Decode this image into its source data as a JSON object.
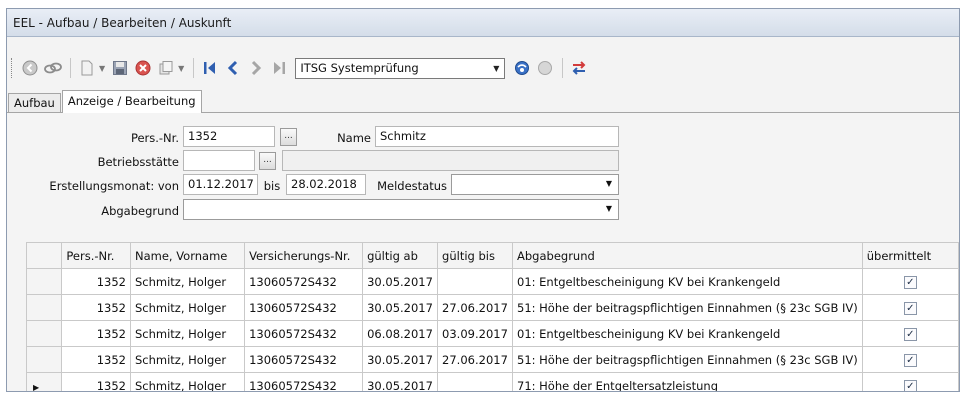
{
  "window": {
    "title": "EEL - Aufbau / Bearbeiten / Auskunft"
  },
  "toolbar": {
    "combo_value": "ITSG Systemprüfung",
    "icons": [
      "back-icon",
      "link-icon",
      "new-document-icon",
      "save-icon",
      "delete-icon",
      "copy-icon",
      "first-record-icon",
      "previous-record-icon",
      "next-record-icon",
      "last-record-icon",
      "run-icon",
      "stop-icon",
      "transfer-icon"
    ]
  },
  "tabs": [
    {
      "label": "Aufbau"
    },
    {
      "label": "Anzeige / Bearbeitung"
    }
  ],
  "form": {
    "pers_nr_label": "Pers.-Nr.",
    "pers_nr_value": "1352",
    "lookup_button": "...",
    "name_label": "Name",
    "name_value": "Schmitz",
    "betriebsstaette_label": "Betriebsstätte",
    "betriebsstaette_value": "",
    "betriebsstaette_desc": "",
    "erstellungsmonat_label": "Erstellungsmonat: von",
    "von_value": "01.12.2017",
    "bis_label": "bis",
    "bis_value": "28.02.2018",
    "meldestatus_label": "Meldestatus",
    "meldestatus_value": "",
    "abgabegrund_label": "Abgabegrund",
    "abgabegrund_value": ""
  },
  "grid": {
    "columns": [
      "Pers.-Nr.",
      "Name, Vorname",
      "Versicherungs-Nr.",
      "gültig ab",
      "gültig bis",
      "Abgabegrund",
      "übermittelt"
    ],
    "rows": [
      {
        "pers_nr": "1352",
        "name": "Schmitz, Holger",
        "vers_nr": "13060572S432",
        "gueltig_ab": "30.05.2017",
        "gueltig_bis": "",
        "abgabegrund": "01: Entgeltbescheinigung KV bei Krankengeld",
        "uebermittelt": "✓"
      },
      {
        "pers_nr": "1352",
        "name": "Schmitz, Holger",
        "vers_nr": "13060572S432",
        "gueltig_ab": "30.05.2017",
        "gueltig_bis": "27.06.2017",
        "abgabegrund": "51: Höhe der beitragspflichtigen Einnahmen (§ 23c SGB IV)",
        "uebermittelt": "✓"
      },
      {
        "pers_nr": "1352",
        "name": "Schmitz, Holger",
        "vers_nr": "13060572S432",
        "gueltig_ab": "06.08.2017",
        "gueltig_bis": "03.09.2017",
        "abgabegrund": "01: Entgeltbescheinigung KV bei Krankengeld",
        "uebermittelt": "✓"
      },
      {
        "pers_nr": "1352",
        "name": "Schmitz, Holger",
        "vers_nr": "13060572S432",
        "gueltig_ab": "30.05.2017",
        "gueltig_bis": "27.06.2017",
        "abgabegrund": "51: Höhe der beitragspflichtigen Einnahmen (§ 23c SGB IV)",
        "uebermittelt": "✓"
      },
      {
        "pers_nr": "1352",
        "name": "Schmitz, Holger",
        "vers_nr": "13060572S432",
        "gueltig_ab": "30.05.2017",
        "gueltig_bis": "",
        "abgabegrund": "71: Höhe der Entgeltersatzleistung",
        "uebermittelt": "✓",
        "current": true
      }
    ],
    "current_row_marker": "▶"
  }
}
